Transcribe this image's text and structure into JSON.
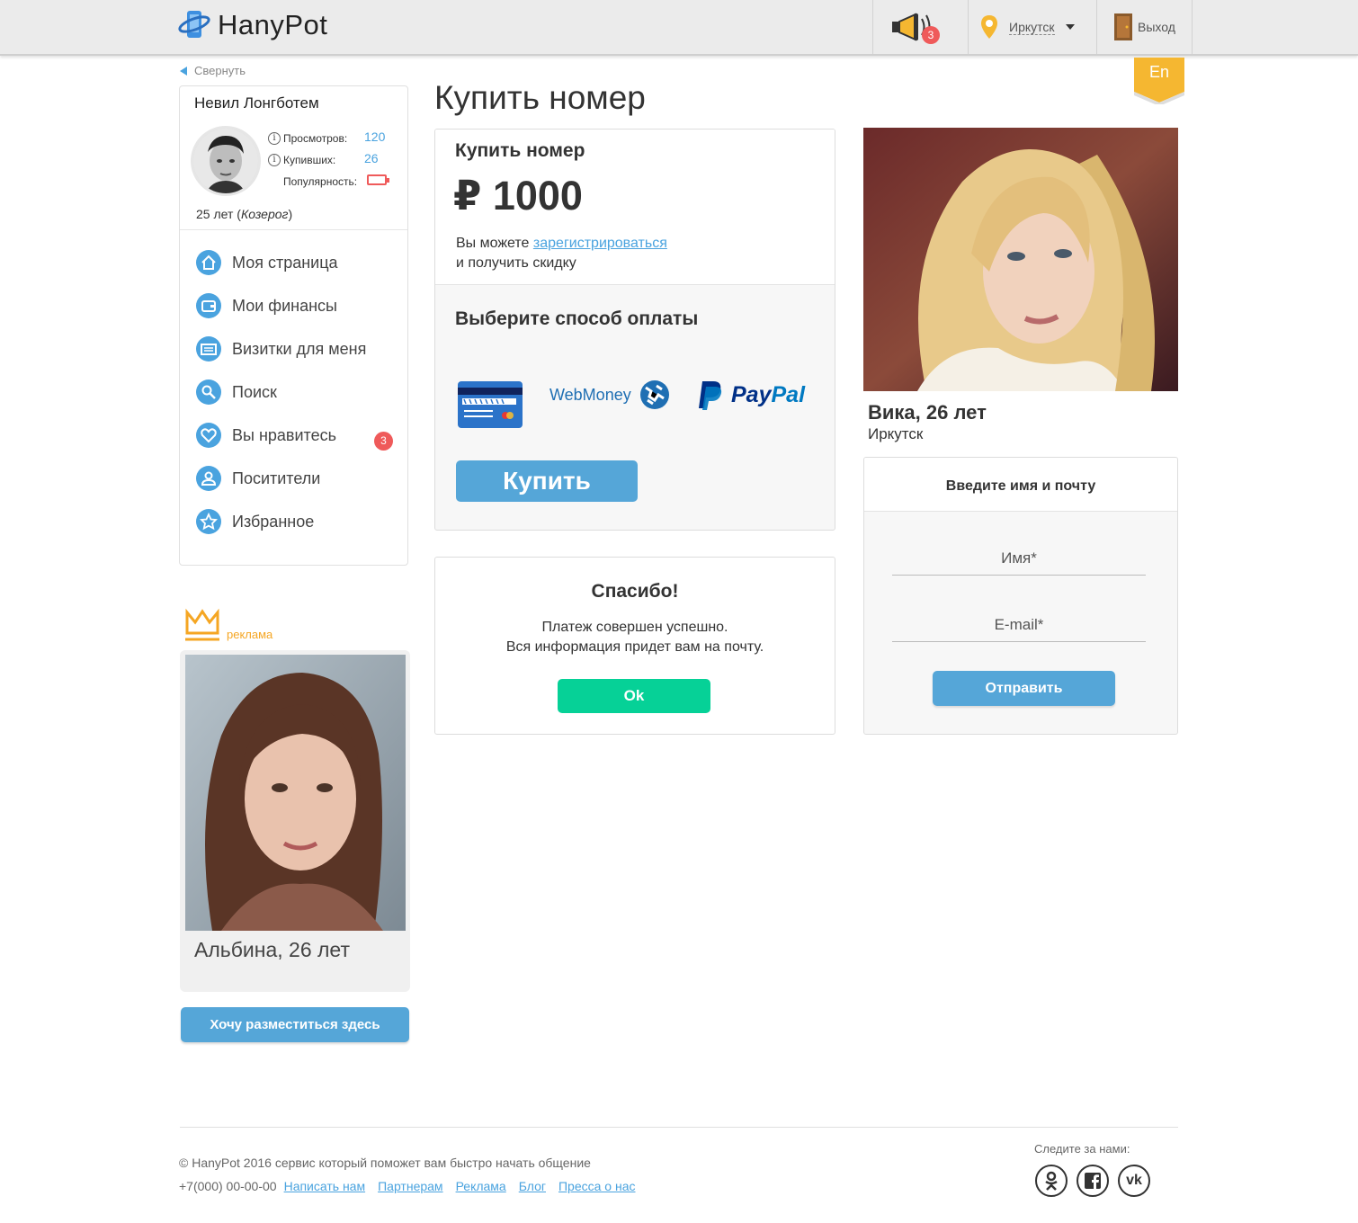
{
  "header": {
    "logo_text": "HanyPot",
    "notifications_count": "3",
    "city": "Иркутск",
    "exit_label": "Выход",
    "language": "En"
  },
  "sidebar": {
    "collapse_label": "Свернуть",
    "profile": {
      "name": "Невил Лонгботем",
      "views_label": "Просмотров:",
      "views_value": "120",
      "buyers_label": "Купивших:",
      "buyers_value": "26",
      "popularity_label": "Популярность:",
      "age_text": "25 лет",
      "zodiac": "Козерог"
    },
    "menu": [
      {
        "label": "Моя страница",
        "icon": "home-icon"
      },
      {
        "label": "Мои финансы",
        "icon": "wallet-icon"
      },
      {
        "label": "Визитки для меня",
        "icon": "card-icon"
      },
      {
        "label": "Поиск",
        "icon": "search-icon"
      },
      {
        "label": "Вы нравитесь",
        "icon": "heart-icon",
        "badge": "3"
      },
      {
        "label": "Поситители",
        "icon": "user-icon"
      },
      {
        "label": "Избранное",
        "icon": "star-icon"
      }
    ],
    "ad": {
      "label": "реклама",
      "name": "Альбина, 26 лет",
      "button": "Хочу разместиться здесь"
    }
  },
  "main": {
    "title": "Купить номер",
    "buy": {
      "heading": "Купить номер",
      "price": "₽ 1000",
      "discount_prefix": "Вы можете ",
      "discount_link": "зарегистрироваться",
      "discount_suffix": "и получить скидку",
      "payment_heading": "Выберите способ оплаты",
      "methods": [
        "card",
        "WebMoney",
        "PayPal"
      ],
      "webmoney_label": "WebMoney",
      "paypal_label": "PayPal",
      "buy_button": "Купить"
    },
    "thanks": {
      "heading": "Спасибо!",
      "line1": "Платеж совершен успешно.",
      "line2": "Вся информация придет вам на почту.",
      "ok_button": "Ok"
    }
  },
  "right": {
    "profile_name": "Вика, 26 лет",
    "profile_city": "Иркутск",
    "form": {
      "heading": "Введите имя и почту",
      "name_placeholder": "Имя*",
      "email_placeholder": "E-mail*",
      "submit": "Отправить"
    }
  },
  "footer": {
    "copyright": "© HanyPot 2016 сервис который поможет вам быстро начать общение",
    "phone": "+7(000) 00-00-00",
    "links": [
      "Написать нам",
      "Партнерам",
      "Реклама",
      "Блог",
      "Пресса о нас"
    ],
    "follow_label": "Следите за нами:",
    "social": [
      "odnoklassniki-icon",
      "facebook-icon",
      "vk-icon"
    ]
  },
  "colors": {
    "accent": "#55a6d8",
    "badge": "#ef5a5a",
    "ok": "#06d197",
    "ribbon": "#f5b731"
  }
}
